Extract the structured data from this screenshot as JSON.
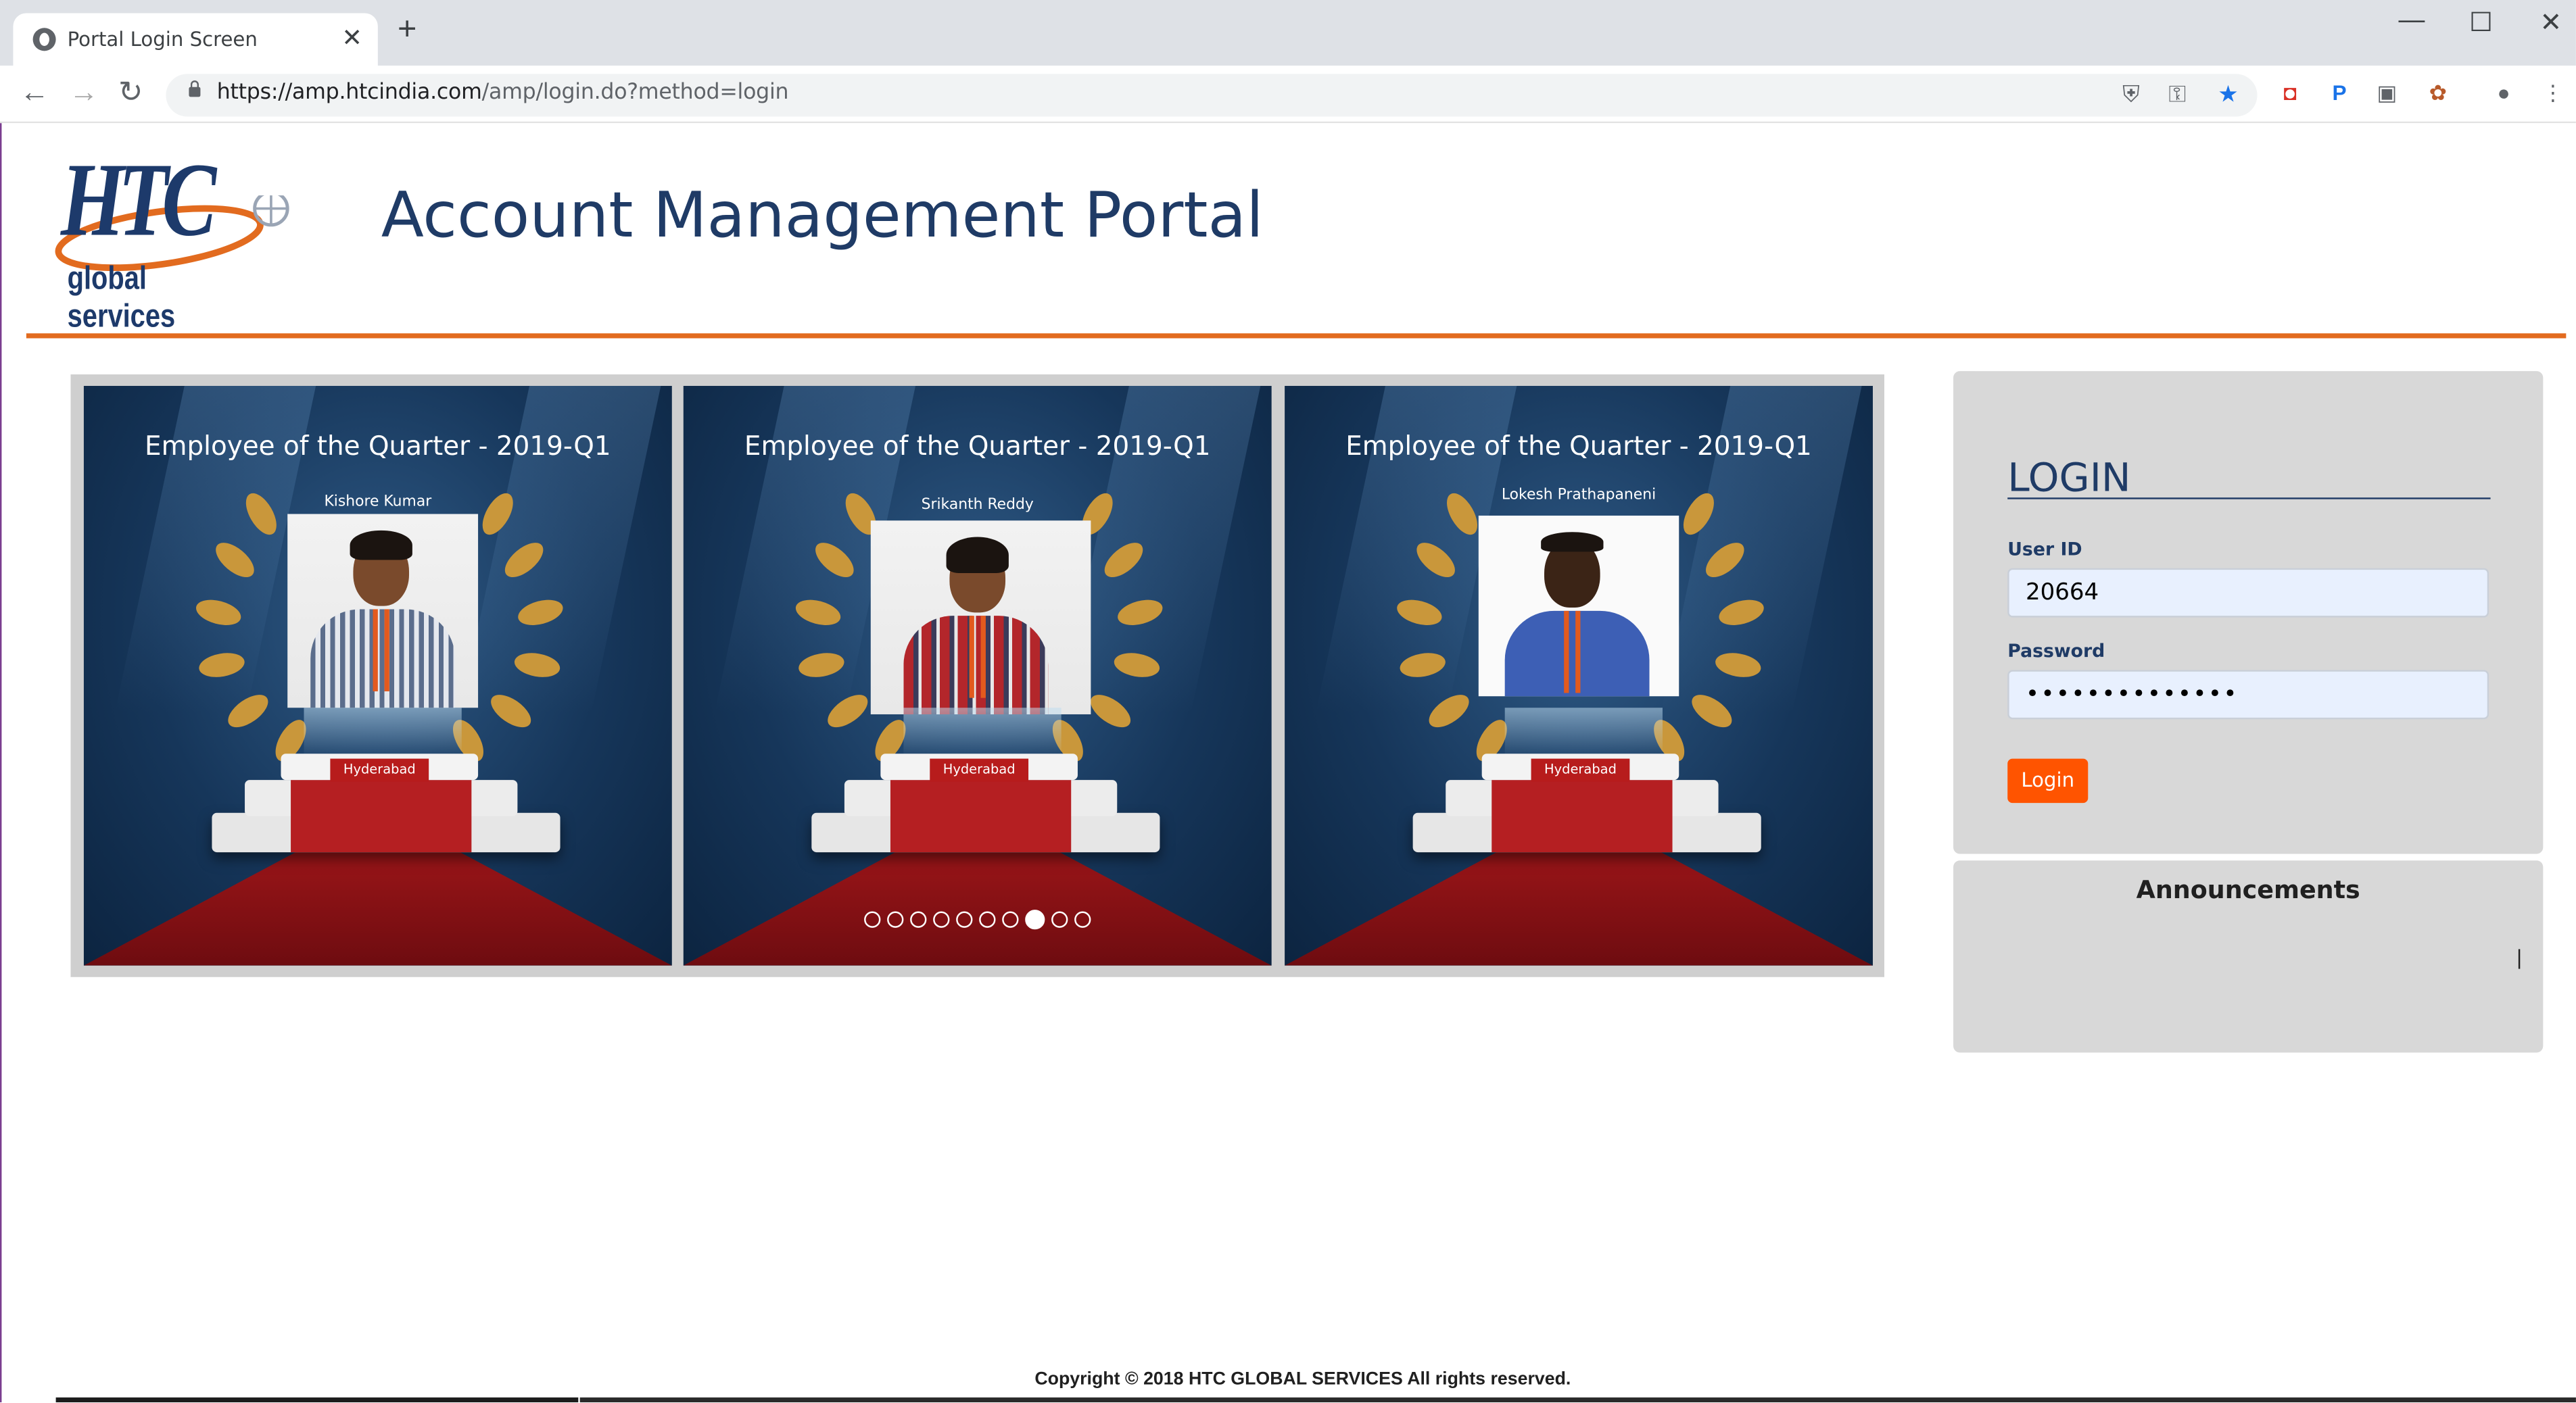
{
  "browser": {
    "tab_title": "Portal Login Screen",
    "url_host": "https://amp.htcindia.com",
    "url_path": "/amp/login.do?method=login",
    "win_minimize": "—",
    "win_maximize": "☐",
    "win_close": "✕"
  },
  "header": {
    "logo_text": "HTC",
    "logo_subtext": "global services",
    "title": "Account Management Portal"
  },
  "carousel": {
    "slides": [
      {
        "heading": "Employee of the Quarter - 2019-Q1",
        "name": "Kishore Kumar",
        "location": "Hyderabad"
      },
      {
        "heading": "Employee of the Quarter - 2019-Q1",
        "name": "Srikanth Reddy",
        "location": "Hyderabad"
      },
      {
        "heading": "Employee of the Quarter - 2019-Q1",
        "name": "Lokesh Prathapaneni",
        "location": "Hyderabad"
      }
    ],
    "dot_count": 10,
    "active_dot": 8
  },
  "login": {
    "heading": "LOGIN",
    "user_id_label": "User ID",
    "user_id_value": "20664",
    "password_label": "Password",
    "password_value": "••••••••••••••",
    "button_label": "Login"
  },
  "announcements": {
    "heading": "Announcements"
  },
  "footer": {
    "copyright": "Copyright © 2018 HTC GLOBAL SERVICES All rights reserved."
  },
  "colors": {
    "brand_navy": "#1f3b66",
    "accent_orange": "#e26b1f",
    "login_button": "#ff5400"
  }
}
